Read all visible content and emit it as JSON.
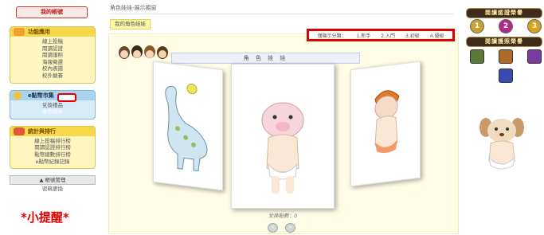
{
  "sidebar": {
    "title": "我的帳號",
    "panels": [
      {
        "title": "功能應用",
        "items": [
          "線上投稿",
          "閱讀認證",
          "閱讀護照",
          "海報徵選",
          "校內表揚",
          "校外競賽"
        ]
      },
      {
        "title": "e點幣市集",
        "items": [
          "兌換禮品",
          "角色娃娃"
        ]
      },
      {
        "title": "統計與排行",
        "items": [
          "線上投稿排行榜",
          "閱讀認證排行榜",
          "點幣總數排行榜",
          "e點幣紀錄記錄"
        ]
      }
    ],
    "account": {
      "header": "▲ 帳號管理",
      "item": "密碼更換"
    }
  },
  "breadcrumb": "角色娃娃-展示櫥窗",
  "section_tag": "我的角色娃娃",
  "filter": {
    "label": "僅顯示分類：",
    "options": [
      "1.新手",
      "2.入門",
      "3.初級",
      "4.優級"
    ]
  },
  "banner_title": "角 色 娃 娃",
  "counter_text": "兌換點數：0",
  "nav": {
    "prev": "<",
    "next": ">"
  },
  "right": {
    "medals_header": "閱讀認證榮譽",
    "medals": [
      "1",
      "2",
      "3"
    ],
    "badges_header": "閱讀護照榮譽"
  },
  "tip": "*小提醒*",
  "colors": {
    "alert_red": "#e00000",
    "panel_yellow": "#f6d84a",
    "panel_blue": "#a9d4f0"
  }
}
